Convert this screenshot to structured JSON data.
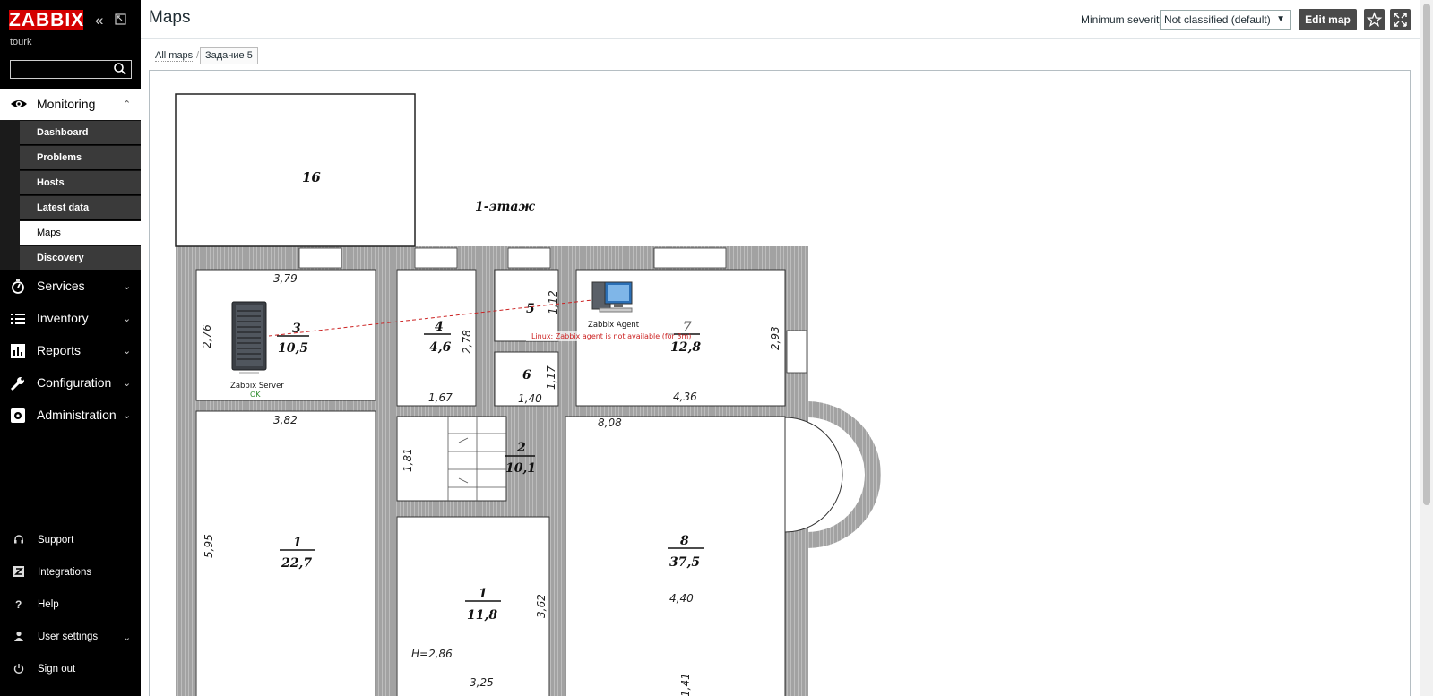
{
  "app": {
    "logo": "ZABBIX",
    "server_name": "tourk"
  },
  "sidebar": {
    "search": {
      "value": "",
      "placeholder": ""
    },
    "monitoring": {
      "label": "Monitoring",
      "submenu": [
        "Dashboard",
        "Problems",
        "Hosts",
        "Latest data",
        "Maps",
        "Discovery"
      ],
      "active": "Maps"
    },
    "menu": [
      {
        "label": "Services",
        "icon": "stopwatch-icon"
      },
      {
        "label": "Inventory",
        "icon": "list-icon"
      },
      {
        "label": "Reports",
        "icon": "bar-chart-icon"
      },
      {
        "label": "Configuration",
        "icon": "wrench-icon"
      },
      {
        "label": "Administration",
        "icon": "gear-icon"
      }
    ],
    "bottom": [
      {
        "label": "Support",
        "icon": "headset-icon"
      },
      {
        "label": "Integrations",
        "icon": "z-icon"
      },
      {
        "label": "Help",
        "icon": "help-icon"
      },
      {
        "label": "User settings",
        "icon": "user-icon"
      },
      {
        "label": "Sign out",
        "icon": "power-icon"
      }
    ]
  },
  "header": {
    "title": "Maps",
    "min_severity_label": "Minimum severity",
    "min_severity_value": "Not classified (default)",
    "edit_map_label": "Edit map"
  },
  "breadcrumb": {
    "root": "All maps",
    "separator": "/",
    "current": "Задание 5"
  },
  "map": {
    "floor_label": "1-этаж",
    "rooms": [
      {
        "num": "16",
        "area": ""
      },
      {
        "num": "3",
        "area": "10,5"
      },
      {
        "num": "4",
        "area": "4,6"
      },
      {
        "num": "5",
        "area": ""
      },
      {
        "num": "6",
        "area": ""
      },
      {
        "num": "7",
        "area": "12,8"
      },
      {
        "num": "2",
        "area": "10,1"
      },
      {
        "num": "1",
        "area": "22,7"
      },
      {
        "num": "1",
        "area": "11,8"
      },
      {
        "num": "8",
        "area": "37,5"
      }
    ],
    "dimensions": [
      "3,79",
      "2,76",
      "2,78",
      "1,12",
      "1,17",
      "2,93",
      "1,67",
      "1,40",
      "4,36",
      "3,82",
      "8,08",
      "1,81",
      "5,95",
      "3,62",
      "4,40",
      "3,25",
      "H=2,86",
      "1,41"
    ],
    "hosts": [
      {
        "name": "Zabbix Server",
        "status": "OK",
        "status_color": "#2a8a2a"
      },
      {
        "name": "Zabbix Agent",
        "problem": "Linux: Zabbix agent is not available (for 3m)",
        "problem_color": "#cc2222"
      }
    ],
    "link_color": "#cc2222"
  }
}
